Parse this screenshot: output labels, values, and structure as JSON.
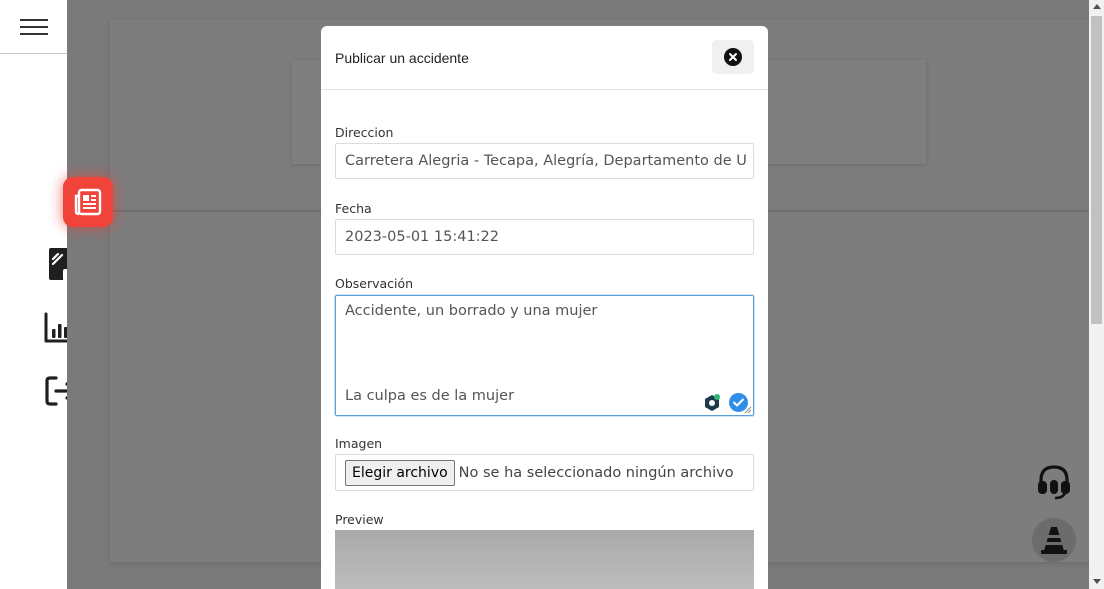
{
  "window": {
    "width": 1104,
    "height": 589
  },
  "sidebar": {
    "menu_icon": "hamburger-icon",
    "items": [
      {
        "icon": "newspaper-icon",
        "active": true
      },
      {
        "icon": "edit-note-icon",
        "active": false
      },
      {
        "icon": "bar-chart-icon",
        "active": false
      },
      {
        "icon": "logout-icon",
        "active": false
      }
    ]
  },
  "floating_buttons": [
    {
      "icon": "headset-icon"
    },
    {
      "icon": "traffic-cone-icon"
    }
  ],
  "modal": {
    "title": "Publicar un accidente",
    "close_icon": "close-icon",
    "fields": {
      "direccion": {
        "label": "Direccion",
        "value": "Carretera Alegria - Tecapa, Alegría, Departamento de U"
      },
      "fecha": {
        "label": "Fecha",
        "value": "2023-05-01 15:41:22"
      },
      "observacion": {
        "label": "Observación",
        "line1": "Accidente, un borrado y una mujer",
        "line2": "La culpa es de la mujer"
      },
      "imagen": {
        "label": "Imagen",
        "button_label": "Elegir archivo",
        "status_text": "No se ha seleccionado ningún archivo"
      },
      "preview": {
        "label": "Preview"
      }
    }
  },
  "colors": {
    "accent_red": "#f0433a",
    "focus_blue": "#5aa0d8",
    "overlay": "#7a7a7a"
  }
}
